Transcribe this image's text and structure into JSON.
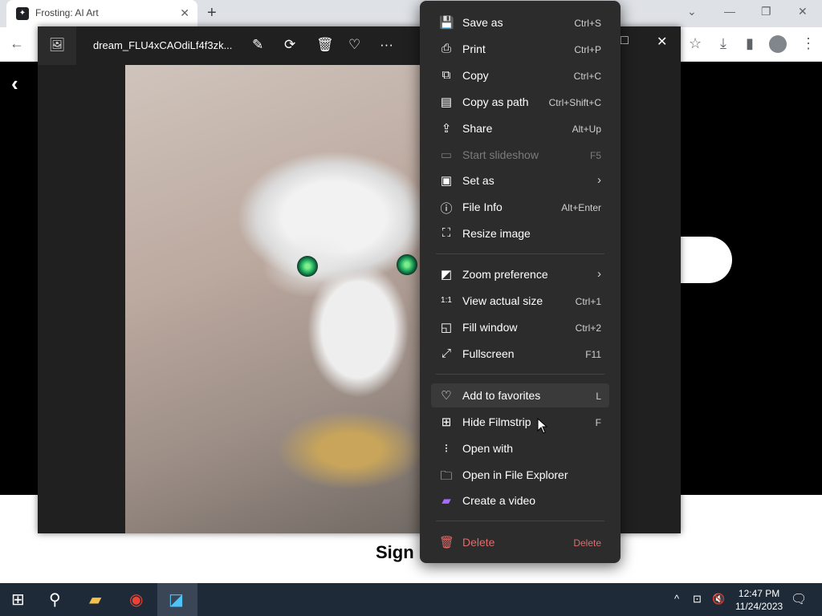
{
  "browser": {
    "tab_title": "Frosting: AI Art",
    "tab_close": "✕",
    "new_tab": "+"
  },
  "page": {
    "signup_text": "Sign"
  },
  "viewer": {
    "filename": "dream_FLU4xCAOdiLf4f3zk...",
    "thumb_icon": "image-icon"
  },
  "menu": {
    "items": [
      {
        "label": "Save as",
        "shortcut": "Ctrl+S",
        "icon": "save-icon"
      },
      {
        "label": "Print",
        "shortcut": "Ctrl+P",
        "icon": "print-icon"
      },
      {
        "label": "Copy",
        "shortcut": "Ctrl+C",
        "icon": "copy-icon"
      },
      {
        "label": "Copy as path",
        "shortcut": "Ctrl+Shift+C",
        "icon": "copy-path-icon"
      },
      {
        "label": "Share",
        "shortcut": "Alt+Up",
        "icon": "share-icon"
      },
      {
        "label": "Start slideshow",
        "shortcut": "F5",
        "icon": "slideshow-icon"
      },
      {
        "label": "Set as",
        "shortcut": "",
        "icon": "set-as-icon"
      },
      {
        "label": "File Info",
        "shortcut": "Alt+Enter",
        "icon": "info-icon"
      },
      {
        "label": "Resize image",
        "shortcut": "",
        "icon": "resize-icon"
      },
      {
        "label": "Zoom preference",
        "shortcut": "",
        "icon": "zoom-icon"
      },
      {
        "label": "View actual size",
        "shortcut": "Ctrl+1",
        "icon": "actual-size-icon"
      },
      {
        "label": "Fill window",
        "shortcut": "Ctrl+2",
        "icon": "fill-window-icon"
      },
      {
        "label": "Fullscreen",
        "shortcut": "F11",
        "icon": "fullscreen-icon"
      },
      {
        "label": "Add to favorites",
        "shortcut": "L",
        "icon": "heart-icon"
      },
      {
        "label": "Hide Filmstrip",
        "shortcut": "F",
        "icon": "filmstrip-icon"
      },
      {
        "label": "Open with",
        "shortcut": "",
        "icon": "open-with-icon"
      },
      {
        "label": "Open in File Explorer",
        "shortcut": "",
        "icon": "folder-icon"
      },
      {
        "label": "Create a video",
        "shortcut": "",
        "icon": "video-icon"
      },
      {
        "label": "Delete",
        "shortcut": "Delete",
        "icon": "trash-icon"
      }
    ]
  },
  "taskbar": {
    "time": "12:47 PM",
    "date": "11/24/2023"
  },
  "colors": {
    "menu_bg": "#2c2c2c",
    "delete_red": "#e06b6b",
    "taskbar_bg": "#1f2a38"
  }
}
